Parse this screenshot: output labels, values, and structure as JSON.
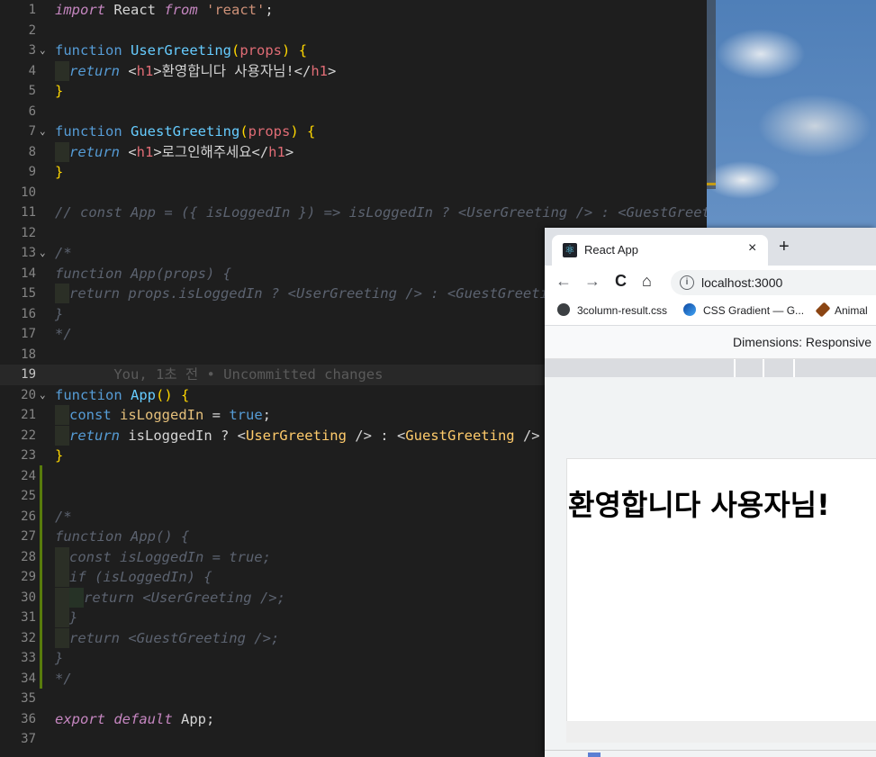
{
  "editor": {
    "lines": [
      {
        "n": "1",
        "html": "<span class='kw'>import</span> React <span class='kw'>from</span> <span class='str'>'react'</span>;"
      },
      {
        "n": "2",
        "html": ""
      },
      {
        "n": "3",
        "fold": "v",
        "html": "<span class='k'>function</span> <span class='fnname'>UserGreeting</span><span class='br'>(</span><span class='prm'>props</span><span class='br'>)</span> <span class='br'>{</span>"
      },
      {
        "n": "4",
        "html": "<span class='ind'></span><span class='ki'>return</span> &lt;<span class='tag'>h1</span>&gt;환영합니다 사용자님!&lt;/<span class='tag'>h1</span>&gt;"
      },
      {
        "n": "5",
        "html": "<span class='br'>}</span>"
      },
      {
        "n": "6",
        "html": ""
      },
      {
        "n": "7",
        "fold": "v",
        "html": "<span class='k'>function</span> <span class='fnname'>GuestGreeting</span><span class='br'>(</span><span class='prm'>props</span><span class='br'>)</span> <span class='br'>{</span>"
      },
      {
        "n": "8",
        "html": "<span class='ind'></span><span class='ki'>return</span> &lt;<span class='tag'>h1</span>&gt;로그인해주세요&lt;/<span class='tag'>h1</span>&gt;"
      },
      {
        "n": "9",
        "html": "<span class='br'>}</span>"
      },
      {
        "n": "10",
        "html": ""
      },
      {
        "n": "11",
        "html": "<span class='cmt'>// const App = ({ isLoggedIn }) =&gt; isLoggedIn ? &lt;UserGreeting /&gt; : &lt;GuestGreeting /&gt;;</span>"
      },
      {
        "n": "12",
        "html": ""
      },
      {
        "n": "13",
        "fold": "v",
        "html": "<span class='cmt'>/*</span>"
      },
      {
        "n": "14",
        "html": "<span class='cmt'>function App(props) {</span>"
      },
      {
        "n": "15",
        "html": "<span class='ind'></span><span class='cmt'>return props.isLoggedIn ? &lt;UserGreeting /&gt; : &lt;GuestGreeting /&gt;</span>"
      },
      {
        "n": "16",
        "html": "<span class='cmt'>}</span>"
      },
      {
        "n": "17",
        "html": "<span class='cmt'>*/</span>"
      },
      {
        "n": "18",
        "html": ""
      },
      {
        "n": "19",
        "cur": true,
        "html": "<span class='blame'>       You, 1초 전 • Uncommitted changes</span>"
      },
      {
        "n": "20",
        "fold": "v",
        "html": "<span class='k'>function</span> <span class='fnname'>App</span><span class='br'>()</span> <span class='br'>{</span>"
      },
      {
        "n": "21",
        "html": "<span class='ind'></span><span class='k'>const</span> <span class='var'>isLoggedIn</span> = <span class='k'>true</span>;"
      },
      {
        "n": "22",
        "html": "<span class='ind'></span><span class='ki'>return</span> isLoggedIn ? &lt;<span class='comp'>UserGreeting</span> /&gt; : &lt;<span class='comp'>GuestGreeting</span> /&gt;"
      },
      {
        "n": "23",
        "html": "<span class='br'>}</span>"
      },
      {
        "n": "24",
        "html": ""
      },
      {
        "n": "25",
        "html": ""
      },
      {
        "n": "26",
        "html": "<span class='cmt'>/*</span>"
      },
      {
        "n": "27",
        "html": "<span class='cmt'>function App() {</span>"
      },
      {
        "n": "28",
        "html": "<span class='ind'></span><span class='cmt'>const isLoggedIn = true;</span>"
      },
      {
        "n": "29",
        "html": "<span class='ind'></span><span class='cmt'>if (isLoggedIn) {</span>"
      },
      {
        "n": "30",
        "html": "<span class='ind'></span><span class='ind2'></span><span class='cmt'>return &lt;UserGreeting /&gt;;</span>"
      },
      {
        "n": "31",
        "html": "<span class='ind'></span><span class='cmt'>}</span>"
      },
      {
        "n": "32",
        "html": "<span class='ind'></span><span class='cmt'>return &lt;GuestGreeting /&gt;;</span>"
      },
      {
        "n": "33",
        "html": "<span class='cmt'>}</span>"
      },
      {
        "n": "34",
        "html": "<span class='cmt'>*/</span>"
      },
      {
        "n": "35",
        "html": ""
      },
      {
        "n": "36",
        "html": "<span class='kw'>export</span> <span class='kw'>default</span> App;"
      },
      {
        "n": "37",
        "html": ""
      }
    ]
  },
  "browser": {
    "tab_title": "React App",
    "tab_close": "×",
    "new_tab": "+",
    "back": "←",
    "forward": "→",
    "reload": "C",
    "home": "⌂",
    "url": "localhost:3000",
    "bookmarks": [
      {
        "label": "3column-result.css",
        "color": "#3c4043"
      },
      {
        "label": "CSS Gradient — G...",
        "color": "#1a73e8"
      },
      {
        "label": "Animal",
        "color": "#8b4513"
      }
    ],
    "dimensions": "Dimensions: Responsive",
    "page_heading": "환영합니다 사용자님!"
  },
  "colors": {
    "editor_bg": "#1e1e1e",
    "accent": "#569cd6"
  }
}
